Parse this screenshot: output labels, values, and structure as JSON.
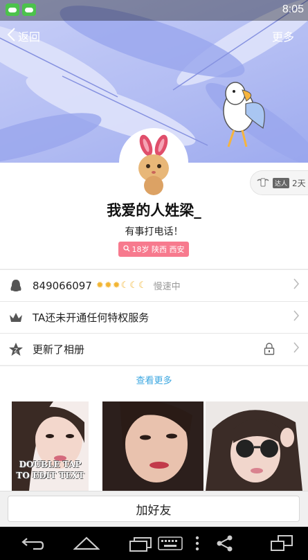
{
  "status_bar": {
    "time": "8:05",
    "notification_icons": [
      "game-controller-icon",
      "game-controller-icon"
    ]
  },
  "header": {
    "back_label": "返回",
    "more_label": "更多"
  },
  "profile": {
    "nickname": "我爱的人姓梁_",
    "signature": "有事打电话！",
    "info_tag": "18岁 陕西 西安",
    "expert_badge": {
      "tag": "达人",
      "days": "2天"
    }
  },
  "rows": {
    "qq": {
      "number": "849066097",
      "level_icons": [
        "sun",
        "sun",
        "sun",
        "moon",
        "moon",
        "moon"
      ],
      "status": "慢速中"
    },
    "privilege": {
      "label": "TA还未开通任何特权服务"
    },
    "album": {
      "label": "更新了相册"
    }
  },
  "see_more_label": "查看更多",
  "photos": [
    {
      "caption": "DOUBLE TAP TO EDIT TEXT"
    },
    {
      "caption": ""
    },
    {
      "caption": ""
    }
  ],
  "actions": {
    "add_friend_label": "加好友"
  },
  "colors": {
    "cover": "#b3bdf3",
    "tag_pink": "#f77a8e",
    "link_blue": "#3aa6e0",
    "level_gold": "#f2b533"
  }
}
